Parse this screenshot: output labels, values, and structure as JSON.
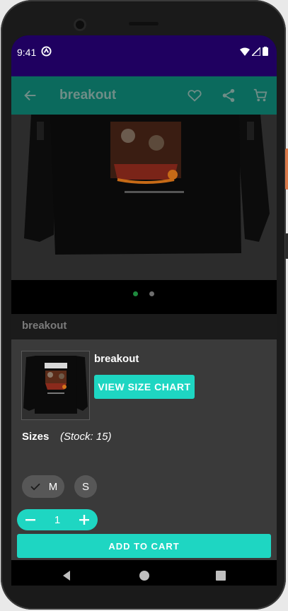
{
  "status_bar": {
    "time": "9:41"
  },
  "app_bar": {
    "title": "breakout",
    "back_icon": "arrow-back-icon",
    "favorite_icon": "heart-outline-icon",
    "share_icon": "share-icon",
    "cart_icon": "shopping-cart-icon"
  },
  "hero": {
    "image_alt": "black long sleeve shirt with illustrated graphic",
    "pager_dots": 2,
    "active_dot": 0
  },
  "product": {
    "title_behind": "breakout"
  },
  "sheet": {
    "product_name": "breakout",
    "size_chart_label": "VIEW SIZE CHART",
    "sizes_label": "Sizes",
    "stock_text": "(Stock: 15)",
    "sizes": [
      {
        "label": "M",
        "selected": true
      },
      {
        "label": "S",
        "selected": false
      }
    ],
    "quantity": "1",
    "add_to_cart_label": "ADD TO CART"
  },
  "colors": {
    "accent": "#1ed6c2",
    "toolbar": "#0b6a5d",
    "status_bar": "#1f0060",
    "pager_active": "#1e8a3e"
  },
  "nav_bar": {
    "back_icon": "nav-back-triangle-icon",
    "home_icon": "nav-home-circle-icon",
    "recents_icon": "nav-recents-square-icon"
  }
}
